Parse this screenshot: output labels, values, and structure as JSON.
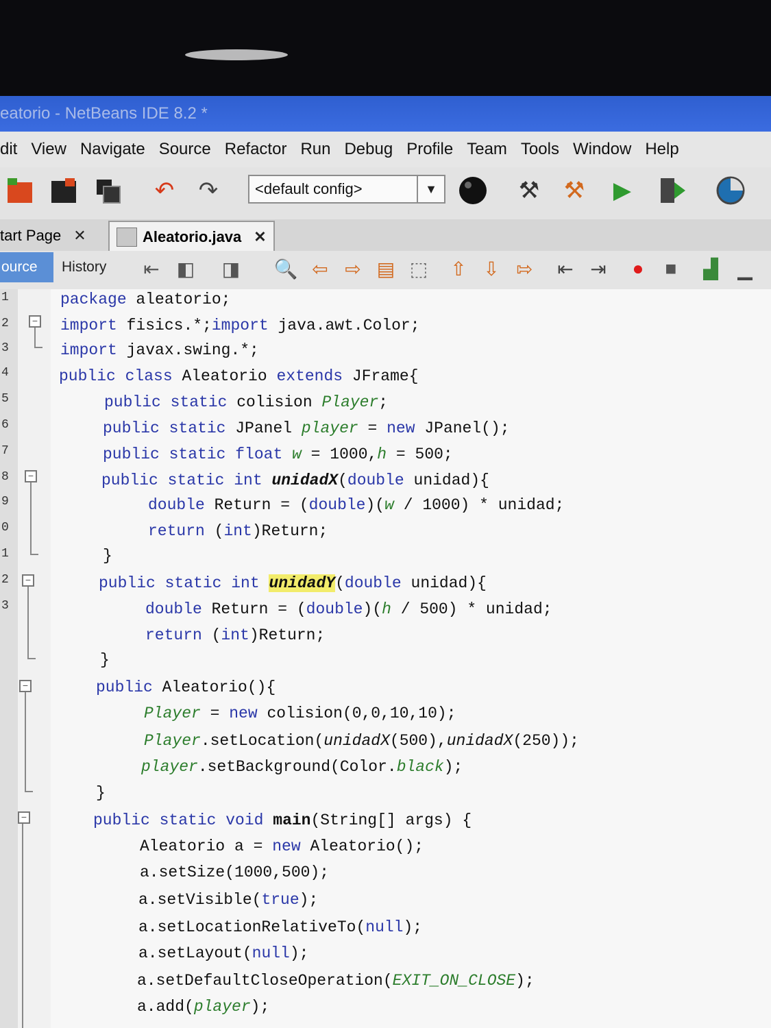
{
  "window": {
    "title": "eatorio - NetBeans IDE 8.2 *"
  },
  "menu": [
    "dit",
    "View",
    "Navigate",
    "Source",
    "Refactor",
    "Run",
    "Debug",
    "Profile",
    "Team",
    "Tools",
    "Window",
    "Help"
  ],
  "toolbar": {
    "config_value": "<default config>"
  },
  "tabs": {
    "start_page": "tart Page",
    "file": "Aleatorio.java"
  },
  "editor_toolbar": {
    "source": "ource",
    "history": "History"
  },
  "line_numbers": [
    "1",
    "2",
    "3",
    "4",
    "5",
    "6",
    "7",
    "8",
    "9",
    "0",
    "1",
    "2",
    "3"
  ],
  "code": {
    "l1a": "package",
    "l1b": " aleatorio;",
    "l2a": "import",
    "l2b": " fisics.*;",
    "l2c": "import",
    "l2d": " java.awt.Color;",
    "l3a": "import",
    "l3b": " javax.swing.*;",
    "l4a": "public class",
    "l4b": " Aleatorio ",
    "l4c": "extends",
    "l4d": " JFrame{",
    "l5a": "public static",
    "l5b": " colision ",
    "l5c": "Player",
    "l5d": ";",
    "l6a": "public static",
    "l6b": " JPanel ",
    "l6c": "player",
    "l6d": " = ",
    "l6e": "new",
    "l6f": " JPanel();",
    "l7a": "public static float",
    "l7b": " ",
    "l7c": "w",
    "l7d": " = 1000,",
    "l7e": "h",
    "l7f": " = 500;",
    "l8a": "public static int",
    "l8b": " ",
    "l8c": "unidadX",
    "l8d": "(",
    "l8e": "double",
    "l8f": " unidad){",
    "l9a": "double",
    "l9b": " Return = (",
    "l9c": "double",
    "l9d": ")(",
    "l9e": "w",
    "l9f": " / 1000) * unidad;",
    "l10a": "return",
    "l10b": " (",
    "l10c": "int",
    "l10d": ")Return;",
    "l11": "}",
    "l12a": "public static int",
    "l12b": " ",
    "l12c": "unidadY",
    "l12d": "(",
    "l12e": "double",
    "l12f": " unidad){",
    "l13a": "double",
    "l13b": " Return = (",
    "l13c": "double",
    "l13d": ")(",
    "l13e": "h",
    "l13f": " / 500) * unidad;",
    "l14a": "return",
    "l14b": " (",
    "l14c": "int",
    "l14d": ")Return;",
    "l15": "}",
    "l16a": "public",
    "l16b": " Aleatorio(){",
    "l17a": "Player",
    "l17b": " = ",
    "l17c": "new",
    "l17d": " colision(0,0,10,10);",
    "l18a": "Player",
    "l18b": ".setLocation(",
    "l18c": "unidadX",
    "l18d": "(500),",
    "l18e": "unidadX",
    "l18f": "(250));",
    "l19a": "player",
    "l19b": ".setBackground(Color.",
    "l19c": "black",
    "l19d": ");",
    "l20": "}",
    "l21a": "public static void",
    "l21b": " ",
    "l21c": "main",
    "l21d": "(String[] args) {",
    "l22a": "Aleatorio a = ",
    "l22b": "new",
    "l22c": " Aleatorio();",
    "l23": "a.setSize(1000,500);",
    "l24a": "a.setVisible(",
    "l24b": "true",
    "l24c": ");",
    "l25a": "a.setLocationRelativeTo(",
    "l25b": "null",
    "l25c": ");",
    "l26a": "a.setLayout(",
    "l26b": "null",
    "l26c": ");",
    "l27a": "a.setDefaultCloseOperation(",
    "l27b": "EXIT_ON_CLOSE",
    "l27c": ");",
    "l28a": "a.add(",
    "l28b": "player",
    "l28c": ");"
  }
}
